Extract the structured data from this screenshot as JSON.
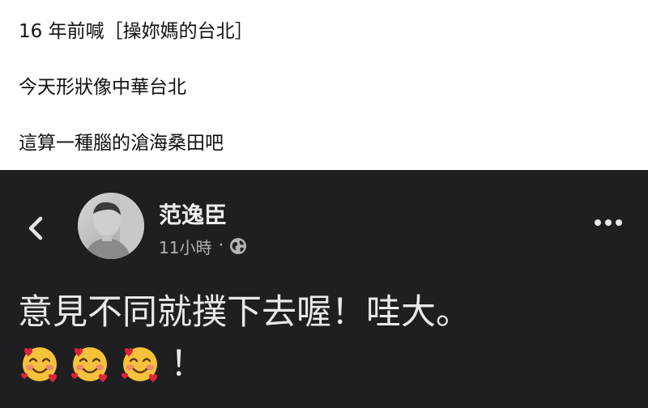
{
  "caption": {
    "line1": "16 年前喊［操妳媽的台北］",
    "line2": "今天形狀像中華台北",
    "line3": "這算一種腦的滄海桑田吧"
  },
  "post": {
    "author_name": "范逸臣",
    "timestamp": "11小時",
    "separator": "·",
    "text": "意見不同就撲下去喔！哇大。",
    "emoji_tail": "！",
    "icons": {
      "back": "chevron-left-icon",
      "privacy": "globe-icon",
      "more": "more-options-icon",
      "emoji": "smiling-face-with-hearts"
    },
    "colors": {
      "background": "#1f1f21",
      "text": "#e9e9e9",
      "meta": "#b0b3b8"
    }
  }
}
